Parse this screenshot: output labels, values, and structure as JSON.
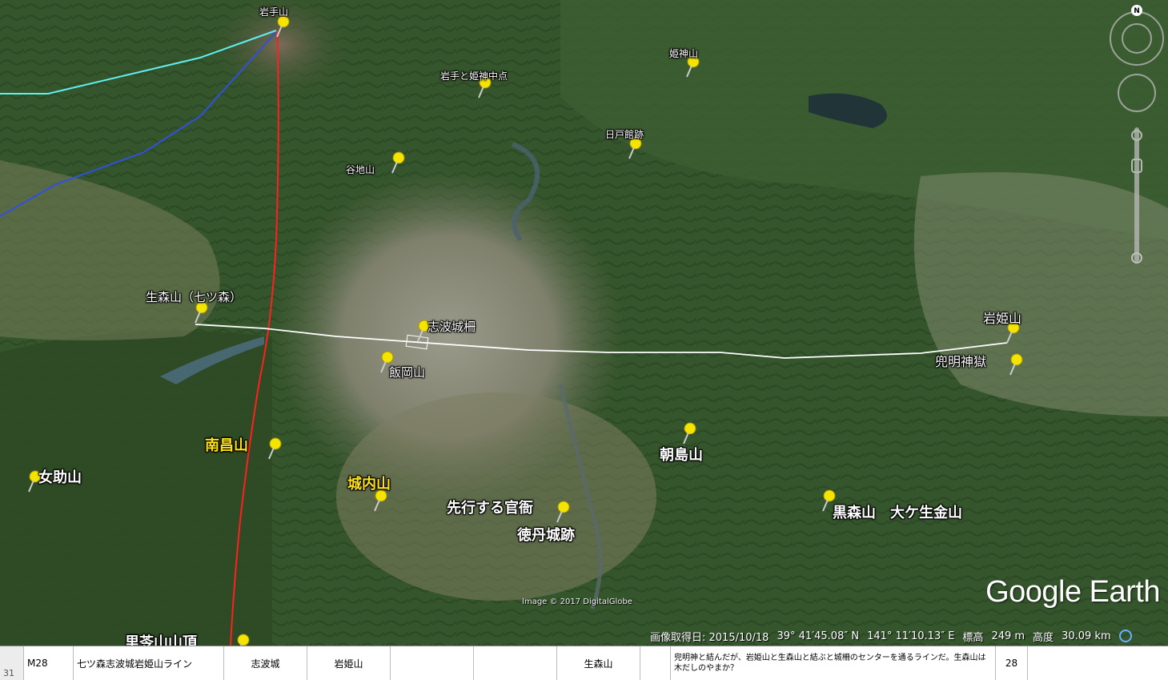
{
  "placemarks": [
    {
      "label": "岩手山",
      "style": "small"
    },
    {
      "label": "姫神山",
      "style": "small"
    },
    {
      "label": "岩手と姫神中点",
      "style": "small"
    },
    {
      "label": "日戸館跡",
      "style": "small"
    },
    {
      "label": "谷地山",
      "style": "small"
    },
    {
      "label": "生森山（七ツ森）",
      "style": "medium"
    },
    {
      "label": "志波城柵",
      "style": "medium"
    },
    {
      "label": "飯岡山",
      "style": "medium"
    },
    {
      "label": "岩姫山",
      "style": "medium"
    },
    {
      "label": "兜明神獄",
      "style": "medium"
    },
    {
      "label": "朝島山",
      "style": "big"
    },
    {
      "label": "南昌山",
      "style": "big-yellow"
    },
    {
      "label": "女助山",
      "style": "big"
    },
    {
      "label": "城内山",
      "style": "big-yellow"
    },
    {
      "label": "先行する官衙",
      "style": "big"
    },
    {
      "label": "徳丹城跡",
      "style": "big"
    },
    {
      "label": "黒森山　大ケ生金山",
      "style": "big"
    },
    {
      "label": "里苓山山頂",
      "style": "big"
    }
  ],
  "lines": [
    {
      "color": "#5ff0f0"
    },
    {
      "color": "#3050e0"
    },
    {
      "color": "#ff2020"
    },
    {
      "color": "#ffffff"
    }
  ],
  "navigation": {
    "compass_letter": "N"
  },
  "branding": {
    "logo": "Google Earth",
    "imagery_credit": "Image © 2017 DigitalGlobe"
  },
  "status": {
    "capture_date": "画像取得日: 2015/10/18",
    "latitude": "39° 41′45.08″ N",
    "longitude": "141° 11′10.13″ E",
    "elevation_label": "標高",
    "elevation_value": "249 m",
    "altitude_label": "高度",
    "altitude_value": "30.09 km"
  },
  "spreadsheet_row": {
    "row_number": "31",
    "cells": [
      "M28",
      "七ツ森志波城岩姫山ライン",
      "志波城",
      "岩姫山",
      "",
      "",
      "生森山",
      ""
    ],
    "note": "兜明神と結んだが、岩姫山と生森山と結ぶと城柵のセンターを通るラインだ。生森山は木だしのやまか？",
    "number": "28"
  }
}
